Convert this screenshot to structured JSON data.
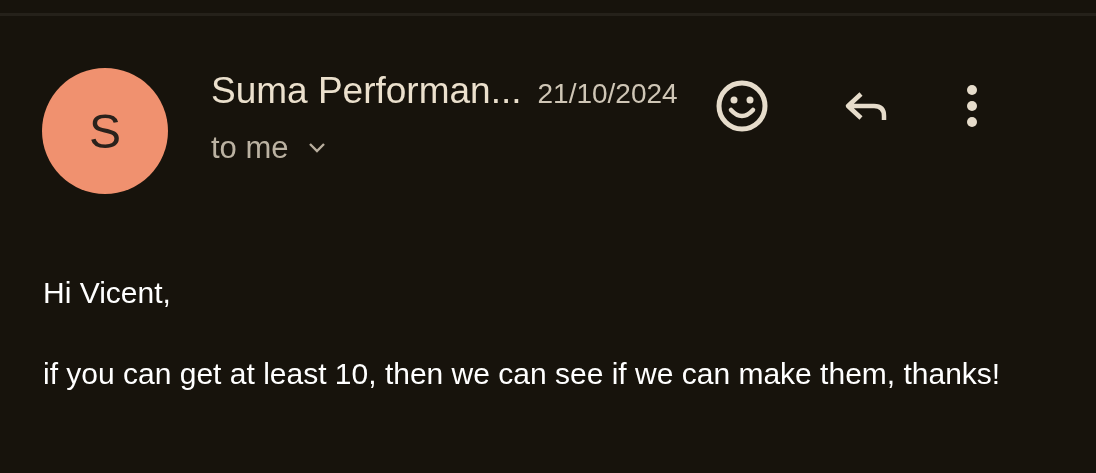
{
  "message": {
    "avatar_letter": "S",
    "sender": "Suma Performan...",
    "date": "21/10/2024",
    "recipient": "to me",
    "body": [
      "Hi Vicent,",
      "if you can get at least 10, then we can see if we can make them, thanks!"
    ]
  }
}
